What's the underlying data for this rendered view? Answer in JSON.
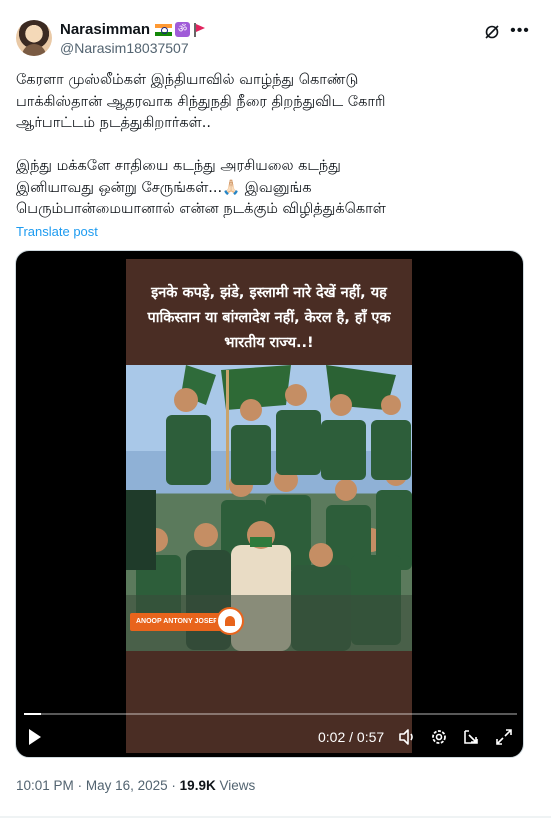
{
  "author": {
    "name": "Narasimman",
    "handle": "@Narasim18037507"
  },
  "tweet": {
    "text": "கேரளா முஸ்லீம்கள் இந்தியாவில் வாழ்ந்து கொண்டு\nபாக்கிஸ்தான் ஆதரவாக சிந்துநதி நீரை திறந்துவிட கோரி\nஆர்பாட்டம் நடத்துகிறார்கள்..\n\nஇந்து மக்களே சாதியை கடந்து அரசியலை கடந்து\nஇனியாவது ஒன்று சேருங்கள்...🙏🏻 இவனுங்க\nபெரும்பான்மையானால் என்ன நடக்கும் விழித்துக்கொள்",
    "translate_label": "Translate post"
  },
  "video": {
    "caption": "इनके कपड़े, झंडे, इस्लामी नारे देखें नहीं, यह पाकिस्तान या बांग्लादेश नहीं, केरल है, हाँ एक भारतीय राज्य..!",
    "name_tag": "ANOOP ANTONY JOSEPH",
    "time_display": "0:02 / 0:57",
    "progress_fraction": 0.035
  },
  "meta": {
    "time": "10:01 PM",
    "date": "May 16, 2025",
    "separator": "·",
    "views_count": "19.9K",
    "views_label": "Views"
  },
  "icons": {
    "more": "more-icon",
    "grok": "grok-icon",
    "play": "play-icon",
    "volume": "volume-icon",
    "settings": "settings-icon",
    "popout": "popout-icon",
    "fullscreen": "fullscreen-icon"
  },
  "colors": {
    "accent": "#1d9bf0",
    "secondary_text": "#536471",
    "name_tag_bg": "#e8641c"
  }
}
